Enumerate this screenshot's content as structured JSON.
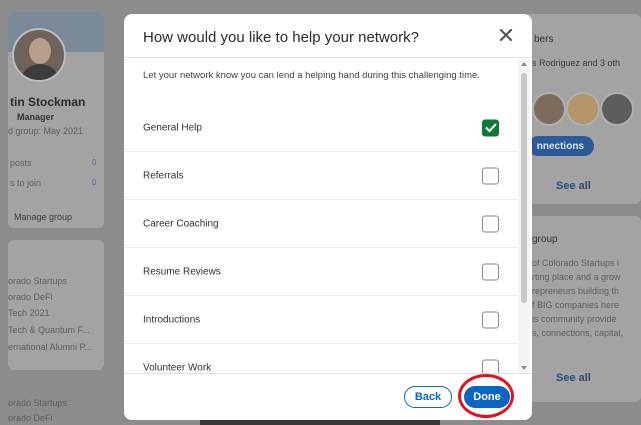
{
  "background": {
    "profile": {
      "name": "tin Stockman",
      "role": "Manager",
      "joined": "d group: May 2021",
      "stats": [
        {
          "label": "posts",
          "value": "0"
        },
        {
          "label": "s to join",
          "value": "0"
        }
      ],
      "manage_label": "Manage group"
    },
    "groups_list": [
      "orado Startups",
      "orado DeFi",
      "Tech 2021",
      "Tech & Quantum F...",
      "ernational Alumni P..."
    ],
    "groups_list_2": [
      "orado Startups",
      "orado DeFi"
    ],
    "right": {
      "members_title": "bers",
      "members_text": "s Rodriguez and 3 oth",
      "connections_label": "nnections",
      "see_all_1": "See all",
      "about_title": "group",
      "about_lines": [
        "of Colorado Startups i",
        "rting place and a grow",
        "repreneurs building th",
        "f BIG companies here",
        "is community provide",
        "s, connections, capital,"
      ],
      "see_all_2": "See all"
    }
  },
  "modal": {
    "title": "How would you like to help your network?",
    "close_icon": "close-icon",
    "intro": "Let your network know you can lend a helping hand during this challenging time.",
    "options": [
      {
        "label": "General Help",
        "checked": true
      },
      {
        "label": "Referrals",
        "checked": false
      },
      {
        "label": "Career Coaching",
        "checked": false
      },
      {
        "label": "Resume Reviews",
        "checked": false
      },
      {
        "label": "Introductions",
        "checked": false
      },
      {
        "label": "Volunteer Work",
        "checked": false
      }
    ],
    "back_label": "Back",
    "done_label": "Done"
  },
  "colors": {
    "accent": "#0a66c2",
    "checked": "#0d7a3a",
    "highlight": "#e0141e"
  }
}
